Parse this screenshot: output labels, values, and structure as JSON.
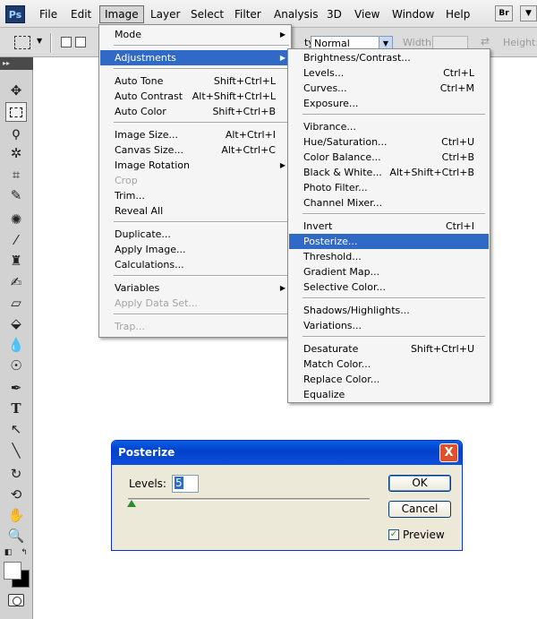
{
  "menubar": {
    "logo": "Ps",
    "items": [
      "File",
      "Edit",
      "Image",
      "Layer",
      "Select",
      "Filter",
      "Analysis",
      "3D",
      "View",
      "Window",
      "Help"
    ],
    "bridge": "Br",
    "extra": "▼"
  },
  "options": {
    "style_label": "tyle:",
    "style_value": "Normal",
    "width_label": "Width:",
    "height_label": "Height:"
  },
  "toolbox": {
    "header": "▸▸"
  },
  "image_menu": {
    "mode": "Mode",
    "adjustments": "Adjustments",
    "auto_tone": "Auto Tone",
    "auto_tone_sc": "Shift+Ctrl+L",
    "auto_contrast": "Auto Contrast",
    "auto_contrast_sc": "Alt+Shift+Ctrl+L",
    "auto_color": "Auto Color",
    "auto_color_sc": "Shift+Ctrl+B",
    "image_size": "Image Size...",
    "image_size_sc": "Alt+Ctrl+I",
    "canvas_size": "Canvas Size...",
    "canvas_size_sc": "Alt+Ctrl+C",
    "image_rotation": "Image Rotation",
    "crop": "Crop",
    "trim": "Trim...",
    "reveal_all": "Reveal All",
    "duplicate": "Duplicate...",
    "apply_image": "Apply Image...",
    "calculations": "Calculations...",
    "variables": "Variables",
    "apply_data_set": "Apply Data Set...",
    "trap": "Trap..."
  },
  "adjustments_menu": {
    "brightness_contrast": "Brightness/Contrast...",
    "levels": "Levels...",
    "levels_sc": "Ctrl+L",
    "curves": "Curves...",
    "curves_sc": "Ctrl+M",
    "exposure": "Exposure...",
    "vibrance": "Vibrance...",
    "hue_saturation": "Hue/Saturation...",
    "hue_saturation_sc": "Ctrl+U",
    "color_balance": "Color Balance...",
    "color_balance_sc": "Ctrl+B",
    "black_white": "Black & White...",
    "black_white_sc": "Alt+Shift+Ctrl+B",
    "photo_filter": "Photo Filter...",
    "channel_mixer": "Channel Mixer...",
    "invert": "Invert",
    "invert_sc": "Ctrl+I",
    "posterize": "Posterize...",
    "threshold": "Threshold...",
    "gradient_map": "Gradient Map...",
    "selective_color": "Selective Color...",
    "shadows_highlights": "Shadows/Highlights...",
    "variations": "Variations...",
    "desaturate": "Desaturate",
    "desaturate_sc": "Shift+Ctrl+U",
    "match_color": "Match Color...",
    "replace_color": "Replace Color...",
    "equalize": "Equalize"
  },
  "dialog": {
    "title": "Posterize",
    "close": "X",
    "levels_label": "Levels:",
    "levels_value": "5",
    "ok": "OK",
    "cancel": "Cancel",
    "preview_label": "Preview",
    "preview_checked": "✓"
  }
}
